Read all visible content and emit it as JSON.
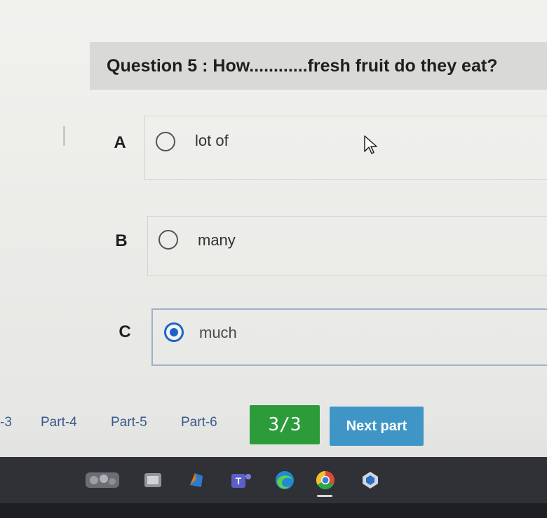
{
  "question": {
    "text": "Question 5 : How............fresh fruit do they eat?"
  },
  "options": [
    {
      "letter": "A",
      "label": "lot of",
      "selected": false
    },
    {
      "letter": "B",
      "label": "many",
      "selected": false
    },
    {
      "letter": "C",
      "label": "much",
      "selected": true
    }
  ],
  "navigation": {
    "parts": [
      "-3",
      "Part-4",
      "Part-5",
      "Part-6"
    ],
    "page_counter": "3/3",
    "next_label": "Next part",
    "colors": {
      "counter": "#2c9c3a",
      "next": "#3f96c6",
      "link": "#3a5a8c"
    }
  },
  "taskbar": {
    "icons": [
      "gallery-app-icon",
      "whiteboard-icon",
      "office-icon",
      "teams-icon",
      "edge-icon",
      "chrome-icon",
      "app-icon"
    ],
    "active": "chrome-icon"
  }
}
